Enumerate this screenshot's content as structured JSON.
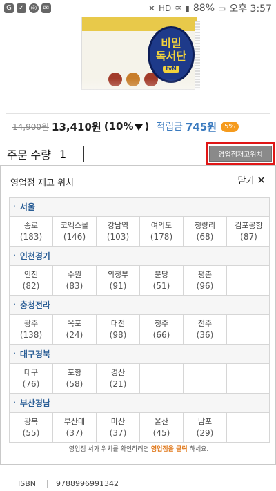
{
  "status_bar": {
    "battery": "88%",
    "time": "오후 3:57"
  },
  "book": {
    "badge_text_line1": "비밀",
    "badge_text_line2": "독서단",
    "badge_tvn": "tvN"
  },
  "price": {
    "original": "14,900원",
    "sale": "13,410원",
    "discount_open": "(10%",
    "discount_close": ")",
    "points_label": "적립금",
    "points_value": "745원",
    "points_rate": "5%"
  },
  "order": {
    "qty_label": "주문 수량",
    "qty_value": "1",
    "stock_button": "영업점재고위치"
  },
  "stock_panel": {
    "title": "영업점 재고 위치",
    "close_label": "닫기",
    "regions": [
      {
        "name": "서울",
        "stores": [
          {
            "name": "종로",
            "count": "(183)"
          },
          {
            "name": "코엑스몰",
            "count": "(146)"
          },
          {
            "name": "강남역",
            "count": "(103)"
          },
          {
            "name": "여의도",
            "count": "(178)"
          },
          {
            "name": "청량리",
            "count": "(68)"
          },
          {
            "name": "김포공항",
            "count": "(87)"
          }
        ]
      },
      {
        "name": "인천경기",
        "stores": [
          {
            "name": "인천",
            "count": "(82)"
          },
          {
            "name": "수원",
            "count": "(83)"
          },
          {
            "name": "의정부",
            "count": "(91)"
          },
          {
            "name": "분당",
            "count": "(51)"
          },
          {
            "name": "평촌",
            "count": "(96)"
          },
          {
            "name": "",
            "count": ""
          }
        ]
      },
      {
        "name": "충청전라",
        "stores": [
          {
            "name": "광주",
            "count": "(138)"
          },
          {
            "name": "목포",
            "count": "(24)"
          },
          {
            "name": "대전",
            "count": "(98)"
          },
          {
            "name": "청주",
            "count": "(66)"
          },
          {
            "name": "전주",
            "count": "(36)"
          },
          {
            "name": "",
            "count": ""
          }
        ]
      },
      {
        "name": "대구경북",
        "stores": [
          {
            "name": "대구",
            "count": "(76)"
          },
          {
            "name": "포항",
            "count": "(58)"
          },
          {
            "name": "경산",
            "count": "(21)"
          },
          {
            "name": "",
            "count": ""
          },
          {
            "name": "",
            "count": ""
          },
          {
            "name": "",
            "count": ""
          }
        ]
      },
      {
        "name": "부산경남",
        "stores": [
          {
            "name": "광복",
            "count": "(55)"
          },
          {
            "name": "부산대",
            "count": "(37)"
          },
          {
            "name": "마산",
            "count": "(37)"
          },
          {
            "name": "울산",
            "count": "(45)"
          },
          {
            "name": "남포",
            "count": "(29)"
          },
          {
            "name": "",
            "count": ""
          }
        ]
      }
    ],
    "note_prefix": "영업점 서가 위치를 확인하려면",
    "note_link": "영업점을 클릭",
    "note_suffix": "하세요."
  },
  "isbn": {
    "label": "ISBN",
    "value": "9788996991342"
  },
  "colors": {
    "highlight_border": "#e01616",
    "link_blue": "#3b7bbf",
    "badge_orange": "#f59b1e",
    "region_header": "#2a5e96"
  }
}
